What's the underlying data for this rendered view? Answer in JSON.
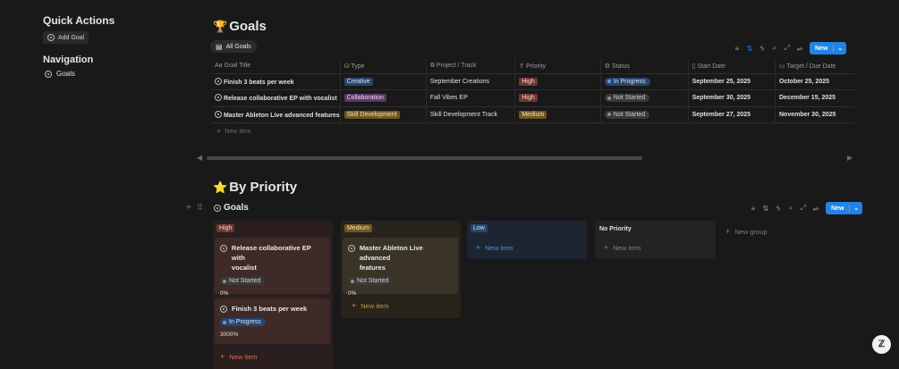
{
  "sidebar": {
    "quick_actions_title": "Quick Actions",
    "add_goal_label": "Add Goal",
    "navigation_title": "Navigation",
    "nav_goals_label": "Goals"
  },
  "goals_view": {
    "title": "Goals",
    "title_emoji": "🏆",
    "tab_label": "All Goals",
    "new_label": "New",
    "columns": [
      "Goal Title",
      "Type",
      "Project / Track",
      "Priority",
      "Status",
      "Start Date",
      "Target / Due Date"
    ],
    "column_icons": [
      "Aa",
      "⛁",
      "⧉",
      "⇑",
      "⚙",
      "▯",
      "▭"
    ],
    "rows": [
      {
        "title": "Finish 3 beats per week",
        "type": "Creative",
        "type_color": "#28456c",
        "project": "September Creations",
        "priority": "High",
        "status": "In Progress",
        "start": "September 25, 2025",
        "due": "October 25, 2025"
      },
      {
        "title": "Release collaborative EP with vocalist",
        "type": "Collaboration",
        "type_color": "#5a3a63",
        "project": "Fall Vibes EP",
        "priority": "High",
        "status": "Not Started",
        "start": "September 30, 2025",
        "due": "December 15, 2025"
      },
      {
        "title": "Master Ableton Live advanced features",
        "type": "Skill Development",
        "type_color": "#6e5722",
        "project": "Skill Development Track",
        "priority": "Medium",
        "status": "Not Started",
        "start": "September 27, 2025",
        "due": "November 30, 2025"
      }
    ],
    "new_item_label": "New item"
  },
  "priority_view": {
    "heading": "By Priority",
    "heading_emoji": "⭐",
    "subtitle": "Goals",
    "new_label": "New",
    "columns": {
      "high": {
        "label": "High",
        "new_item": "New item"
      },
      "medium": {
        "label": "Medium",
        "new_item": "New item"
      },
      "low": {
        "label": "Low",
        "new_item": "New item"
      },
      "none": {
        "label": "No Priority",
        "new_item": "New item"
      }
    },
    "new_group_label": "New group",
    "cards": {
      "high_1": {
        "title_line1": "Release collaborative EP with",
        "title_line2": "vocalist",
        "status": "Not Started",
        "progress": "0%"
      },
      "high_2": {
        "title": "Finish 3 beats per week",
        "status": "In Progress",
        "progress": "3000%"
      },
      "medium_1": {
        "title_line1": "Master Ableton Live advanced",
        "title_line2": "features",
        "status": "Not Started",
        "progress": "0%"
      }
    }
  },
  "colors": {
    "accent": "#2383e2",
    "high": "#6e3630",
    "medium": "#6e5722",
    "low": "#28456c"
  }
}
